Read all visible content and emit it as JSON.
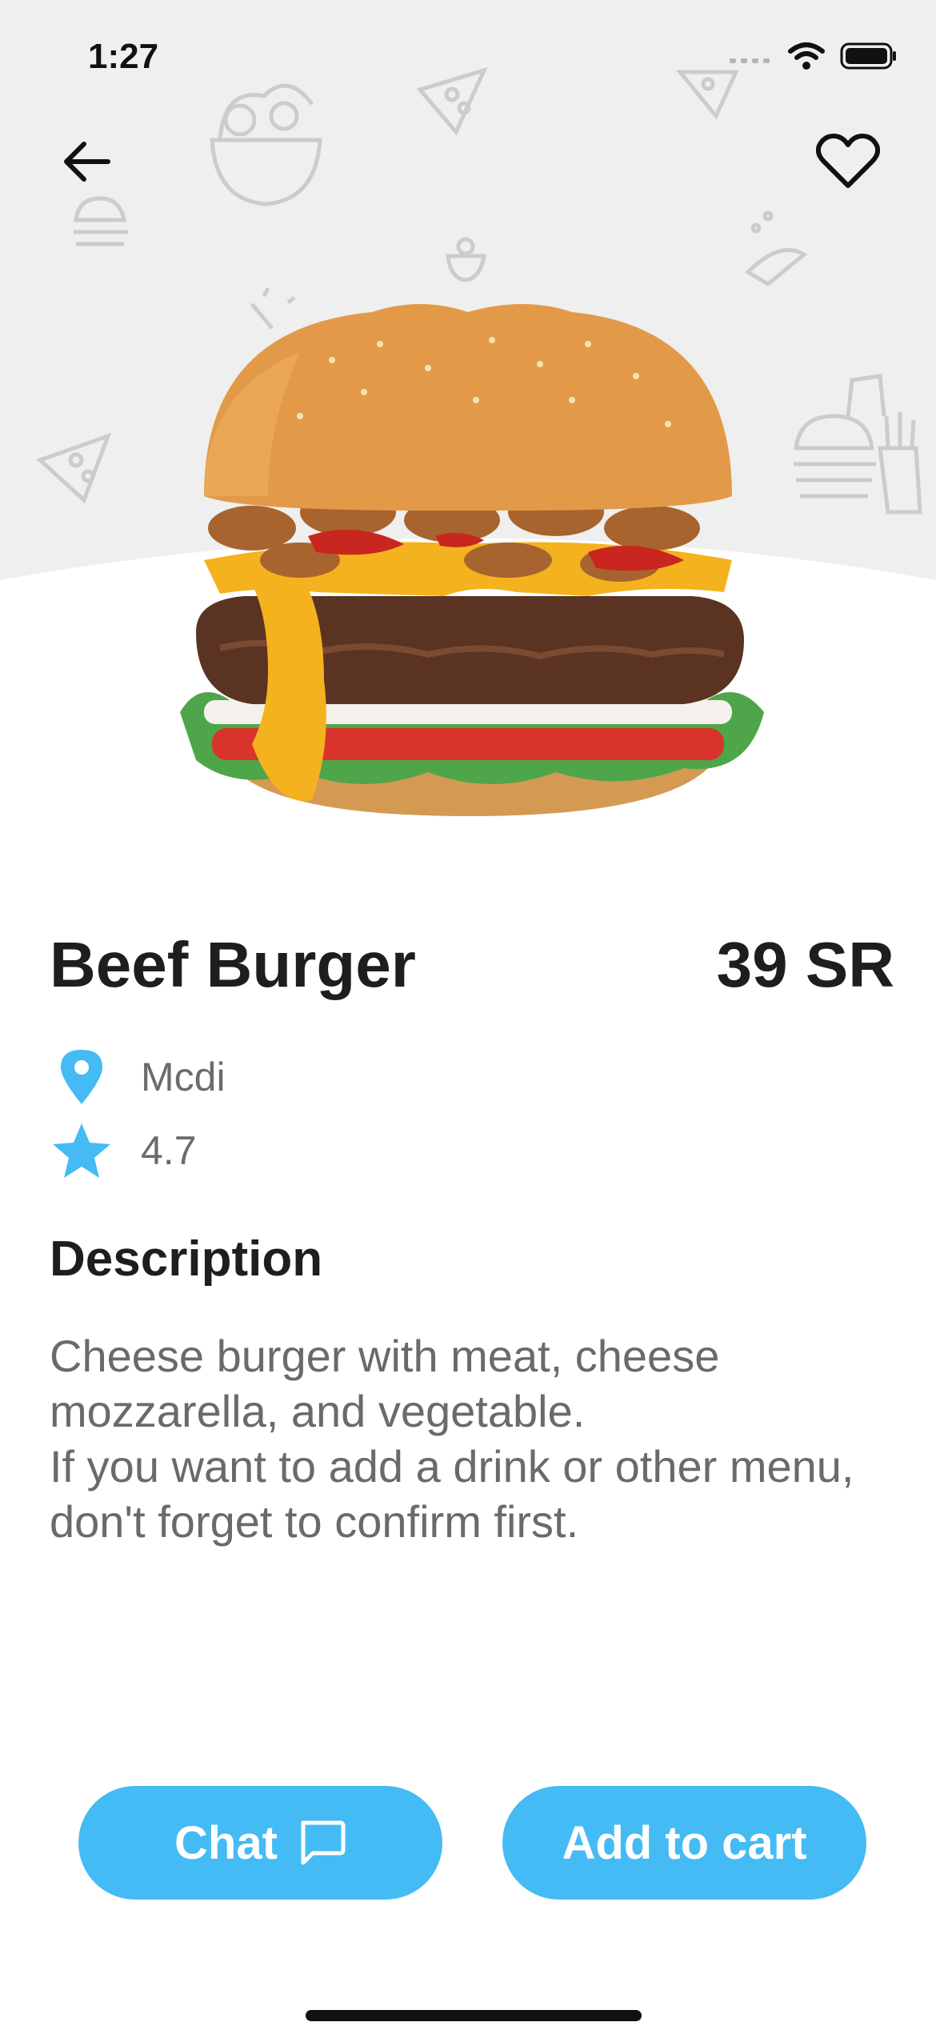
{
  "status_bar": {
    "time": "1:27"
  },
  "product": {
    "name": "Beef Burger",
    "price": "39 SR",
    "restaurant": "Mcdi",
    "rating": "4.7"
  },
  "description": {
    "heading": "Description",
    "text": "Cheese burger with meat, cheese mozzarella, and vegetable.\nIf you want to add a drink or other menu, don't forget to confirm first."
  },
  "actions": {
    "chat_label": "Chat",
    "add_to_cart_label": "Add to cart"
  },
  "colors": {
    "accent": "#44bbf4",
    "hero_background": "#efefef",
    "title_text": "#1e1e1e",
    "body_text": "#6a6a6a"
  },
  "icons": [
    "back-arrow-icon",
    "heart-icon",
    "location-pin-icon",
    "star-icon",
    "chat-bubble-icon",
    "signal-icon",
    "wifi-icon",
    "battery-icon"
  ]
}
